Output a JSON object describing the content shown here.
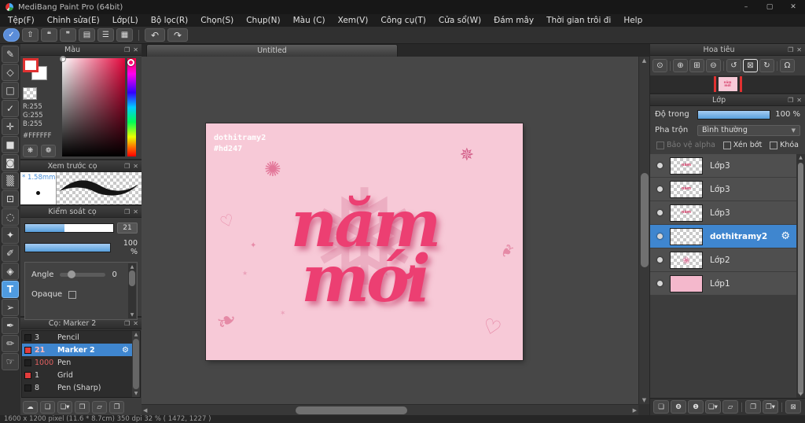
{
  "window": {
    "title": "MediBang Paint Pro (64bit)",
    "controls": [
      {
        "name": "minimize",
        "glyph": "–"
      },
      {
        "name": "maximize",
        "glyph": "▢"
      },
      {
        "name": "close",
        "glyph": "✕"
      }
    ]
  },
  "menu": [
    "Tệp(F)",
    "Chỉnh sửa(E)",
    "Lớp(L)",
    "Bộ lọc(R)",
    "Chọn(S)",
    "Chụp(N)",
    "Màu (C)",
    "Xem(V)",
    "Công cụ(T)",
    "Cửa sổ(W)",
    "Đám mây",
    "Thời gian trôi đi",
    "Help"
  ],
  "toolbar": {
    "buttons": [
      {
        "name": "cloud-sync",
        "glyph": "✓"
      },
      {
        "name": "export",
        "glyph": "⇧"
      },
      {
        "name": "chat",
        "glyph": "❝"
      },
      {
        "name": "comment",
        "glyph": "❞"
      },
      {
        "name": "document",
        "glyph": "▤"
      },
      {
        "name": "material-list",
        "glyph": "☰"
      },
      {
        "name": "pixel-grid",
        "glyph": "▦"
      }
    ],
    "undo": "↶",
    "redo": "↷"
  },
  "tools": [
    {
      "name": "brush",
      "glyph": "✎"
    },
    {
      "name": "eraser",
      "glyph": "◇"
    },
    {
      "name": "shape-brush",
      "glyph": "□"
    },
    {
      "name": "dot-pen",
      "glyph": "✓"
    },
    {
      "name": "move",
      "glyph": "✛"
    },
    {
      "name": "select-move",
      "glyph": "■"
    },
    {
      "name": "bucket",
      "glyph": "◙"
    },
    {
      "name": "gradient",
      "glyph": "▒"
    },
    {
      "name": "select",
      "glyph": "⊡"
    },
    {
      "name": "lasso",
      "glyph": "◌"
    },
    {
      "name": "magic-wand",
      "glyph": "✦"
    },
    {
      "name": "select-pen",
      "glyph": "✐"
    },
    {
      "name": "select-eraser",
      "glyph": "◈"
    },
    {
      "name": "text",
      "glyph": "T"
    },
    {
      "name": "operation",
      "glyph": "➢"
    },
    {
      "name": "eyedropper",
      "glyph": "✒"
    },
    {
      "name": "divide",
      "glyph": "✏"
    },
    {
      "name": "hand",
      "glyph": "☞"
    }
  ],
  "panel_icons": {
    "popout": "❐",
    "close": "✕"
  },
  "color_panel": {
    "title": "Màu",
    "r": "R:255",
    "g": "G:255",
    "b": "B:255",
    "hex": "#FFFFFF",
    "palette_glyph": "❋",
    "palette_add_glyph": "❁"
  },
  "brush_preview": {
    "title": "Xem trước cọ",
    "size": "* 1.58mm"
  },
  "brush_control": {
    "title": "Kiểm soát cọ",
    "size_value": "21",
    "opacity_value": "100 %",
    "angle_label": "Angle",
    "angle_value": "0",
    "opaque_label": "Opaque"
  },
  "brush_panel": {
    "title": "Cọ: Marker 2",
    "gear_glyph": "⚙",
    "brushes": [
      {
        "size": "3",
        "name": "Pencil"
      },
      {
        "size": "21",
        "name": "Marker 2"
      },
      {
        "size": "1000",
        "name": "Pen"
      },
      {
        "size": "1",
        "name": "Grid"
      },
      {
        "size": "8",
        "name": "Pen (Sharp)"
      }
    ],
    "footer": [
      {
        "name": "cloud-brush",
        "glyph": "☁"
      },
      {
        "name": "add-brush",
        "glyph": "❏"
      },
      {
        "name": "add-brush-menu",
        "glyph": "❏▾"
      },
      {
        "name": "script-brush",
        "glyph": "❒"
      },
      {
        "name": "brush-folder",
        "glyph": "▱"
      },
      {
        "name": "duplicate-brush",
        "glyph": "❐"
      }
    ]
  },
  "canvas": {
    "tab": "Untitled",
    "watermark": [
      "dothitramy2",
      "#hd247"
    ],
    "art": [
      "năm",
      "mới"
    ],
    "decorations": [
      {
        "name": "snowflake",
        "glyph": "❅"
      },
      {
        "name": "heart",
        "glyph": "♡"
      },
      {
        "name": "heart",
        "glyph": "♡"
      },
      {
        "name": "star",
        "glyph": "✦"
      },
      {
        "name": "star",
        "glyph": "★"
      },
      {
        "name": "firework",
        "glyph": "✺"
      },
      {
        "name": "sparkle",
        "glyph": "✵"
      },
      {
        "name": "leaf",
        "glyph": "❧"
      },
      {
        "name": "leaf",
        "glyph": "❧"
      },
      {
        "name": "star",
        "glyph": "✶"
      }
    ]
  },
  "navigator": {
    "title": "Hoa tiêu",
    "buttons": [
      {
        "name": "zoom-actual",
        "glyph": "⊙"
      },
      {
        "name": "zoom-in",
        "glyph": "⊕"
      },
      {
        "name": "fit-screen",
        "glyph": "⊞"
      },
      {
        "name": "zoom-out",
        "glyph": "⊖"
      },
      {
        "name": "rotate-left",
        "glyph": "↺"
      },
      {
        "name": "reset-rotation",
        "glyph": "⊠"
      },
      {
        "name": "rotate-right",
        "glyph": "↻"
      },
      {
        "name": "rotation-lock",
        "glyph": "Ω"
      }
    ]
  },
  "layer_panel": {
    "title": "Lớp",
    "opacity_label": "Độ trong",
    "opacity_value": "100 %",
    "blend_label": "Pha trộn",
    "blend_value": "Bình thường",
    "checkboxes": [
      "Bảo vệ alpha",
      "Xén bớt",
      "Khóa"
    ],
    "gear_glyph": "⚙",
    "layers": [
      {
        "name": "Lớp3"
      },
      {
        "name": "Lớp3"
      },
      {
        "name": "Lớp3"
      },
      {
        "name": "dothitramy2"
      },
      {
        "name": "Lớp2"
      },
      {
        "name": "Lớp1"
      }
    ],
    "footer": [
      {
        "name": "add-layer",
        "glyph": "❏"
      },
      {
        "name": "add-8bit-layer",
        "glyph": "❽"
      },
      {
        "name": "add-1bit-layer",
        "glyph": "❶"
      },
      {
        "name": "add-layer-menu",
        "glyph": "❏▾"
      },
      {
        "name": "layer-folder",
        "glyph": "▱"
      },
      {
        "name": "duplicate-layer",
        "glyph": "❐"
      },
      {
        "name": "merge-layer",
        "glyph": "❐▾"
      },
      {
        "name": "delete-layer",
        "glyph": "⊠"
      }
    ]
  },
  "statusbar": {
    "text": "1600 x 1200 pixel   (11.6 * 8.7cm)   350 dpi   32 %   ( 1472, 1227 )"
  },
  "colors": {
    "accent": "#3f86cf",
    "canvas_pink": "#f7c9d7",
    "hot_pink": "#ec3f72",
    "swatch_red": "#e23c3c"
  }
}
